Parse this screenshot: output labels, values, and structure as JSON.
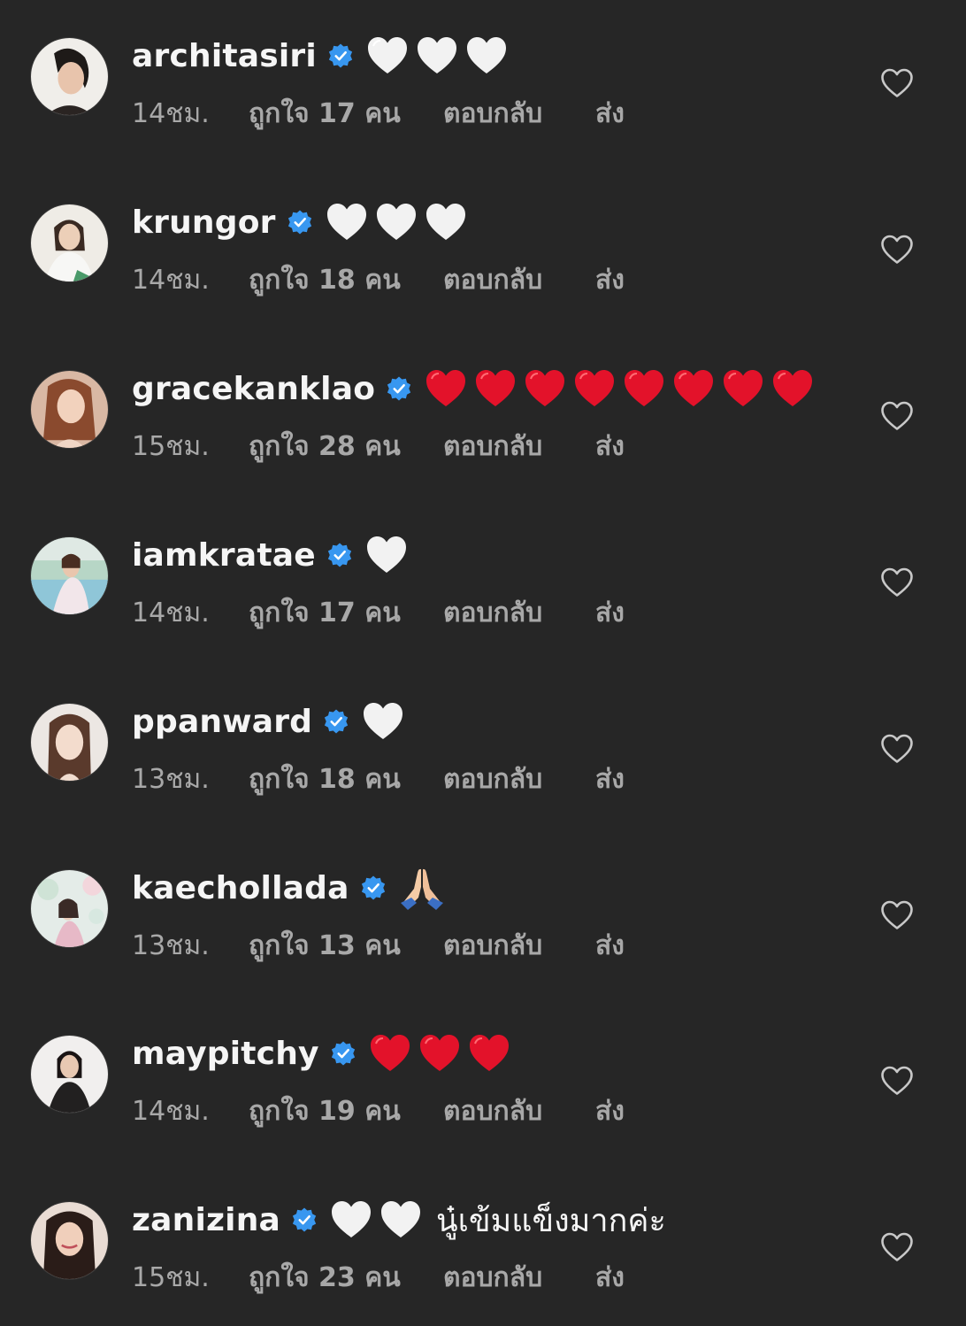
{
  "comments": [
    {
      "username": "architasiri",
      "verified": true,
      "emojis": [
        "white-heart",
        "white-heart",
        "white-heart"
      ],
      "text": "",
      "time": "14ชม.",
      "likes": "ถูกใจ 17 คน",
      "reply": "ตอบกลับ",
      "send": "ส่ง"
    },
    {
      "username": "krungor",
      "verified": true,
      "emojis": [
        "white-heart",
        "white-heart",
        "white-heart"
      ],
      "text": "",
      "time": "14ชม.",
      "likes": "ถูกใจ 18 คน",
      "reply": "ตอบกลับ",
      "send": "ส่ง"
    },
    {
      "username": "gracekanklao",
      "verified": true,
      "emojis": [
        "red-heart",
        "red-heart",
        "red-heart",
        "red-heart",
        "red-heart",
        "red-heart",
        "red-heart",
        "red-heart"
      ],
      "text": "",
      "time": "15ชม.",
      "likes": "ถูกใจ 28 คน",
      "reply": "ตอบกลับ",
      "send": "ส่ง"
    },
    {
      "username": "iamkratae",
      "verified": true,
      "emojis": [
        "white-heart"
      ],
      "text": "",
      "time": "14ชม.",
      "likes": "ถูกใจ 17 คน",
      "reply": "ตอบกลับ",
      "send": "ส่ง"
    },
    {
      "username": "ppanward",
      "verified": true,
      "emojis": [
        "white-heart"
      ],
      "text": "",
      "time": "13ชม.",
      "likes": "ถูกใจ 18 คน",
      "reply": "ตอบกลับ",
      "send": "ส่ง"
    },
    {
      "username": "kaechollada",
      "verified": true,
      "emojis": [
        "folded-hands"
      ],
      "text": "",
      "time": "13ชม.",
      "likes": "ถูกใจ 13 คน",
      "reply": "ตอบกลับ",
      "send": "ส่ง"
    },
    {
      "username": "maypitchy",
      "verified": true,
      "emojis": [
        "red-heart",
        "red-heart",
        "red-heart"
      ],
      "text": "",
      "time": "14ชม.",
      "likes": "ถูกใจ 19 คน",
      "reply": "ตอบกลับ",
      "send": "ส่ง"
    },
    {
      "username": "zanizina",
      "verified": true,
      "emojis": [
        "white-heart",
        "white-heart"
      ],
      "text": "นู๋เข้มแข็งมากค่ะ",
      "time": "15ชม.",
      "likes": "ถูกใจ 23 คน",
      "reply": "ตอบกลับ",
      "send": "ส่ง"
    }
  ],
  "colors": {
    "background": "#262626",
    "username": "#f5f5f5",
    "meta": "#a8a8a8",
    "verified": "#3897f0",
    "red_heart": "#e3122a",
    "white_heart": "#f2f2f2"
  },
  "icons": {
    "verified": "verified-badge-icon",
    "like": "heart-outline-icon"
  }
}
